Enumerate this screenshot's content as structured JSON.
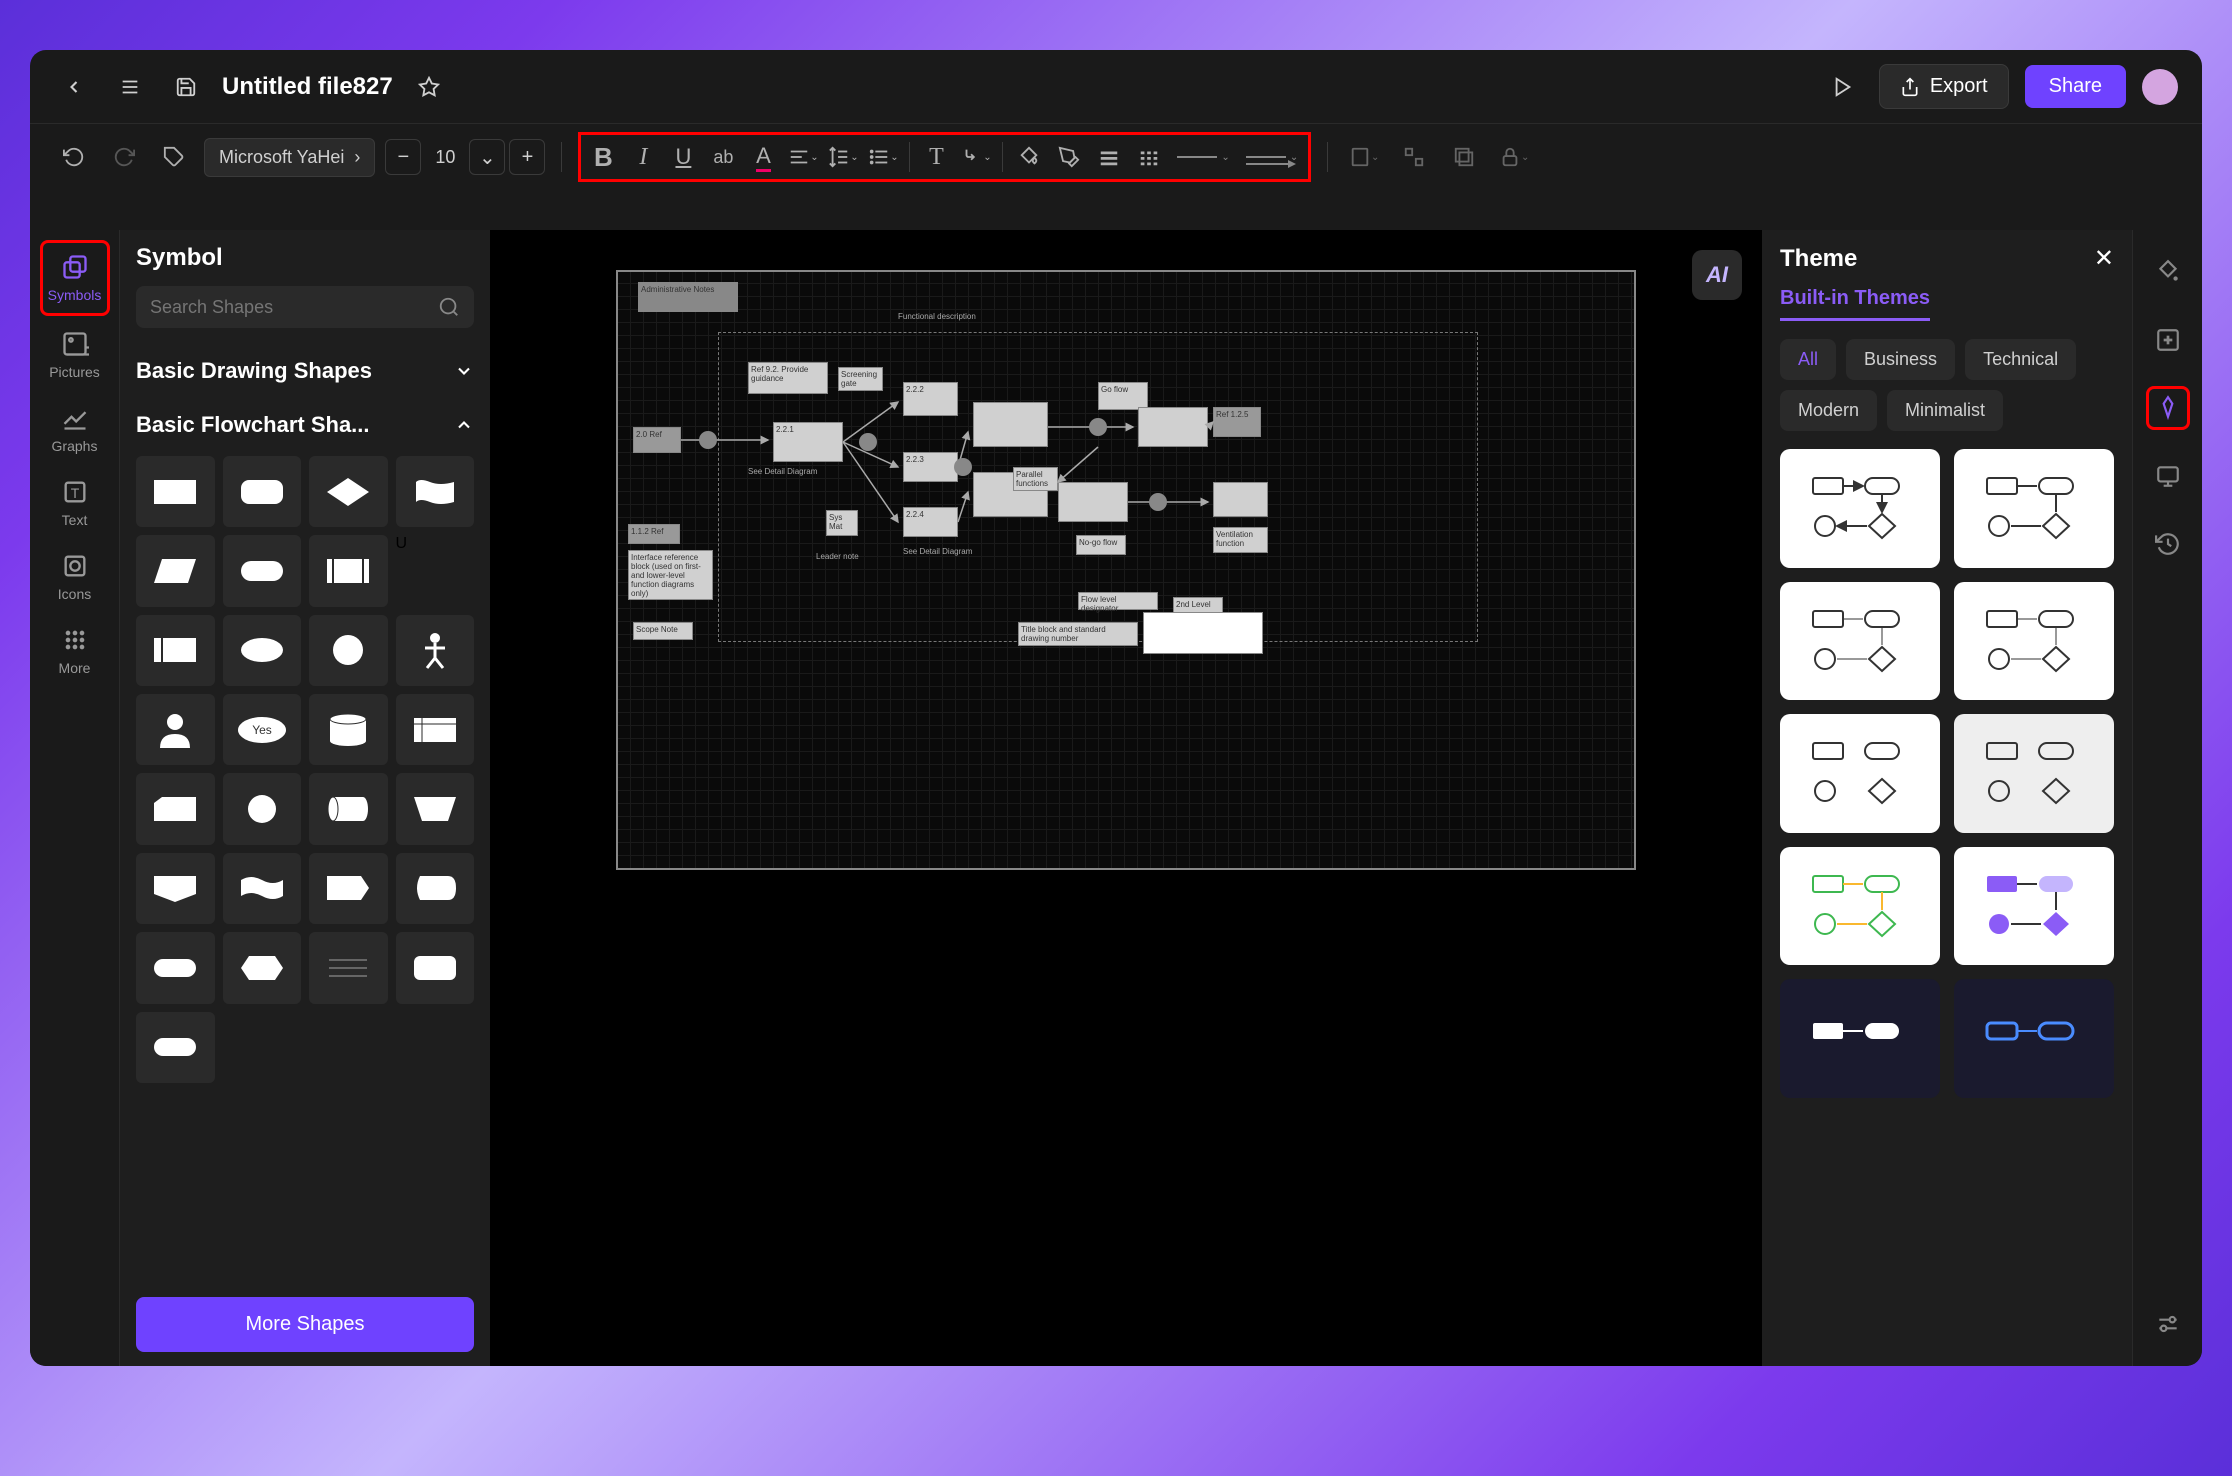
{
  "header": {
    "file_title": "Untitled file827",
    "export_label": "Export",
    "share_label": "Share"
  },
  "toolbar": {
    "font_family": "Microsoft YaHei",
    "font_size": "10"
  },
  "left_rail": [
    {
      "label": "Symbols",
      "icon": "copy"
    },
    {
      "label": "Pictures",
      "icon": "image"
    },
    {
      "label": "Graphs",
      "icon": "chart"
    },
    {
      "label": "Text",
      "icon": "text"
    },
    {
      "label": "Icons",
      "icon": "target"
    },
    {
      "label": "More",
      "icon": "grid"
    }
  ],
  "symbol_panel": {
    "title": "Symbol",
    "search_placeholder": "Search Shapes",
    "categories": [
      {
        "name": "Basic Drawing Shapes",
        "expanded": false
      },
      {
        "name": "Basic Flowchart Sha...",
        "expanded": true
      }
    ],
    "more_label": "More Shapes",
    "yes_shape_label": "Yes"
  },
  "theme_panel": {
    "title": "Theme",
    "tab": "Built-in Themes",
    "filters": [
      "All",
      "Business",
      "Technical",
      "Modern",
      "Minimalist"
    ],
    "active_filter": "All"
  },
  "canvas": {
    "ai_label": "AI",
    "labels": {
      "functional_desc": "Functional description",
      "ref92": "Ref 9.2. Provide guidance",
      "screening": "Screening gate",
      "go_flow": "Go flow",
      "no_go_flow": "No-go flow",
      "parallel": "Parallel functions",
      "see_detail": "See Detail Diagram",
      "see_detail2": "See Detail Diagram",
      "leader_note": "Leader note",
      "sys_mat": "Sys Mat",
      "ventilation": "Ventilation function",
      "interface_block": "Interface reference block (used on first-and lower-level function diagrams only)",
      "flow_designator": "Flow level designator",
      "second_level": "2nd Level",
      "title_block": "Title block and standard drawing number",
      "scope_note": "Scope Note",
      "ref_box": "Ref 1.2.5",
      "adm_notes": "Administrative Notes",
      "box_221": "2.2.1",
      "box_222": "2.2.2",
      "box_223": "2.2.3",
      "box_224": "2.2.4",
      "start_ref": "2.0 Ref",
      "small_112": "1.1.2 Ref"
    }
  }
}
